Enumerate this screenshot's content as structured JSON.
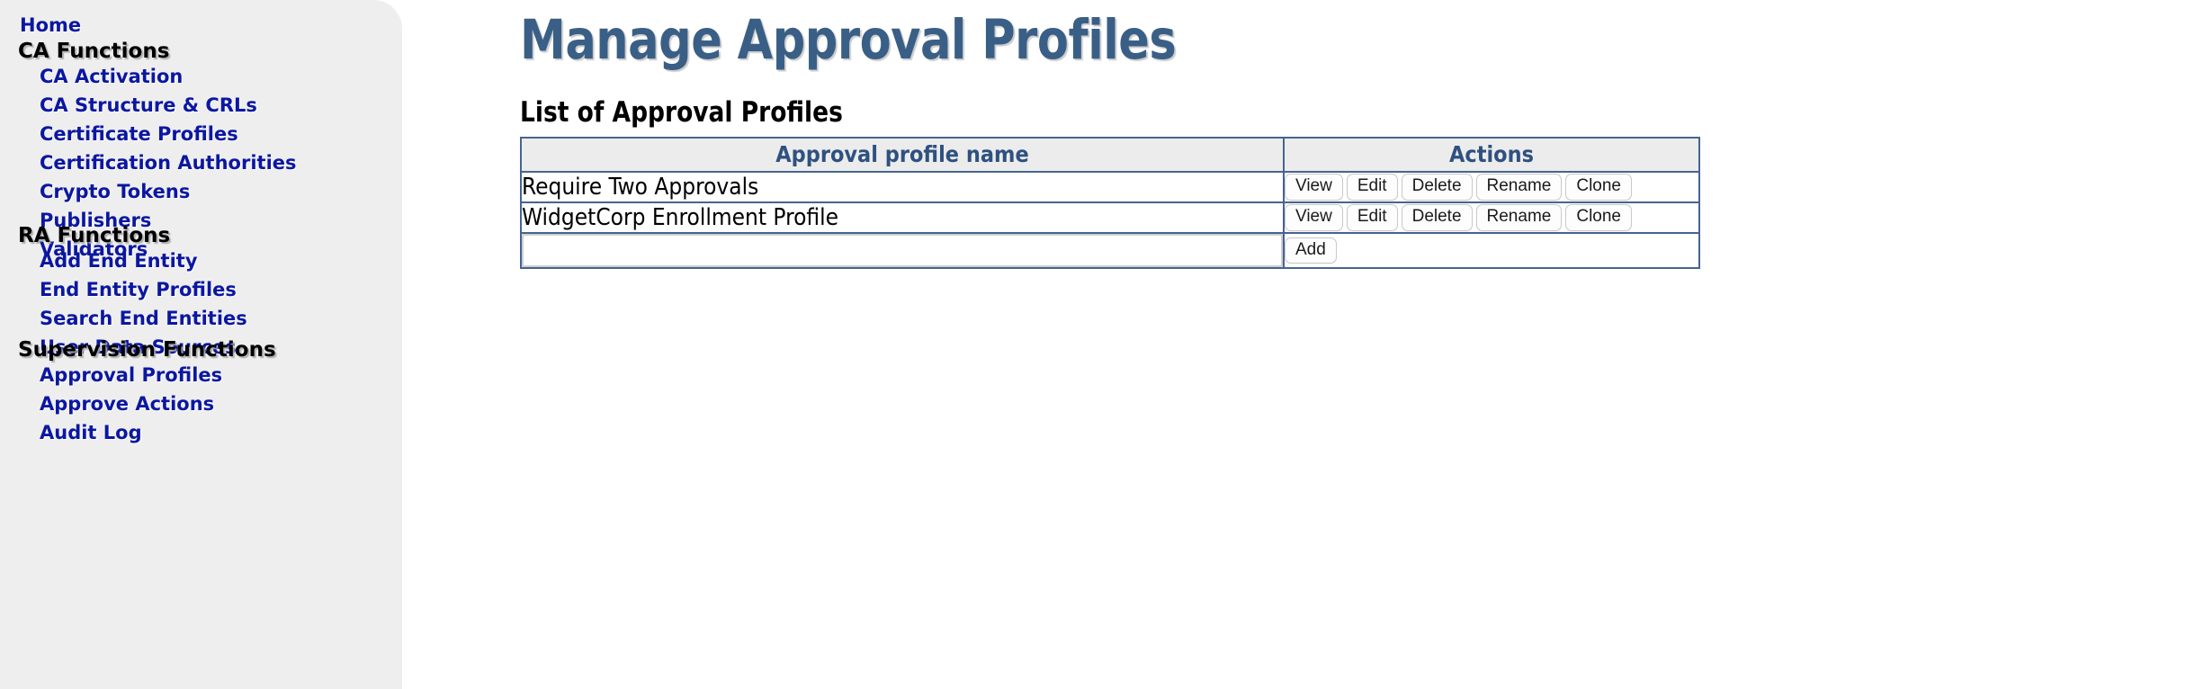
{
  "sidebar": {
    "home_label": "Home",
    "groups": [
      {
        "title": "CA Functions",
        "items": [
          {
            "label": "CA Activation"
          },
          {
            "label": "CA Structure & CRLs"
          },
          {
            "label": "Certificate Profiles"
          },
          {
            "label": "Certification Authorities"
          },
          {
            "label": "Crypto Tokens"
          },
          {
            "label": "Publishers"
          },
          {
            "label": "Validators"
          }
        ]
      },
      {
        "title": "RA Functions",
        "items": [
          {
            "label": "Add End Entity"
          },
          {
            "label": "End Entity Profiles"
          },
          {
            "label": "Search End Entities"
          },
          {
            "label": "User Data Sources"
          }
        ]
      },
      {
        "title": "Supervision Functions",
        "items": [
          {
            "label": "Approval Profiles"
          },
          {
            "label": "Approve Actions"
          },
          {
            "label": "Audit Log"
          }
        ]
      }
    ]
  },
  "main": {
    "page_title": "Manage Approval Profiles",
    "section_title": "List of Approval Profiles",
    "table": {
      "headers": {
        "name": "Approval profile name",
        "actions": "Actions"
      },
      "rows": [
        {
          "name": "Require Two Approvals",
          "actions": [
            "View",
            "Edit",
            "Delete",
            "Rename",
            "Clone"
          ]
        },
        {
          "name": "WidgetCorp Enrollment Profile",
          "actions": [
            "View",
            "Edit",
            "Delete",
            "Rename",
            "Clone"
          ]
        }
      ],
      "add_row": {
        "input_value": "",
        "input_placeholder": "",
        "add_label": "Add"
      }
    }
  },
  "colors": {
    "sidebar_bg": "#eeeeee",
    "link_blue": "#0b17a0",
    "title_blue": "#3a5f86",
    "table_border": "#46648f",
    "table_header_bg": "#ececec",
    "table_header_text": "#2f5180"
  }
}
